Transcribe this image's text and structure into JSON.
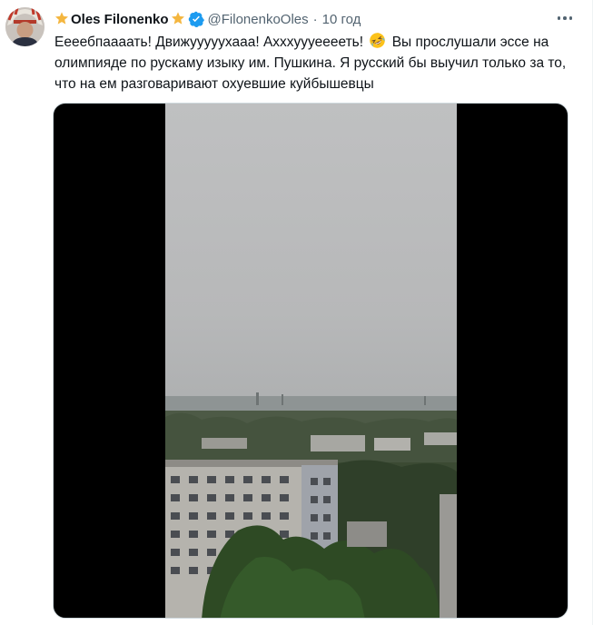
{
  "tweet": {
    "author_name": "Oles Filonenko",
    "handle": "@FilonenkoOles",
    "separator": "·",
    "time": "10 год",
    "text_before_emoji": "Еееебпаааать! Движууууухааа! Ахххуууееееть!",
    "text_after_emoji": "Вы прослушали эссе на олимпияде по рускаму изыку им. Пушкина. Я русский бы выучил только за то, что на ем разговаривают охуевшие куйбышевцы",
    "emoji": "rolling-on-floor-laughing-emoji"
  },
  "colors": {
    "text": "#0f1419",
    "secondary": "#536471",
    "verified": "#1d9bf0",
    "star": "#f4b63f",
    "video_letterbox": "#000000",
    "sky": "#b9babb"
  },
  "icons": {
    "name_prefix": "star-icon",
    "name_suffix": "star-icon",
    "verified": "verified-badge-icon",
    "more": "more-options-icon"
  }
}
